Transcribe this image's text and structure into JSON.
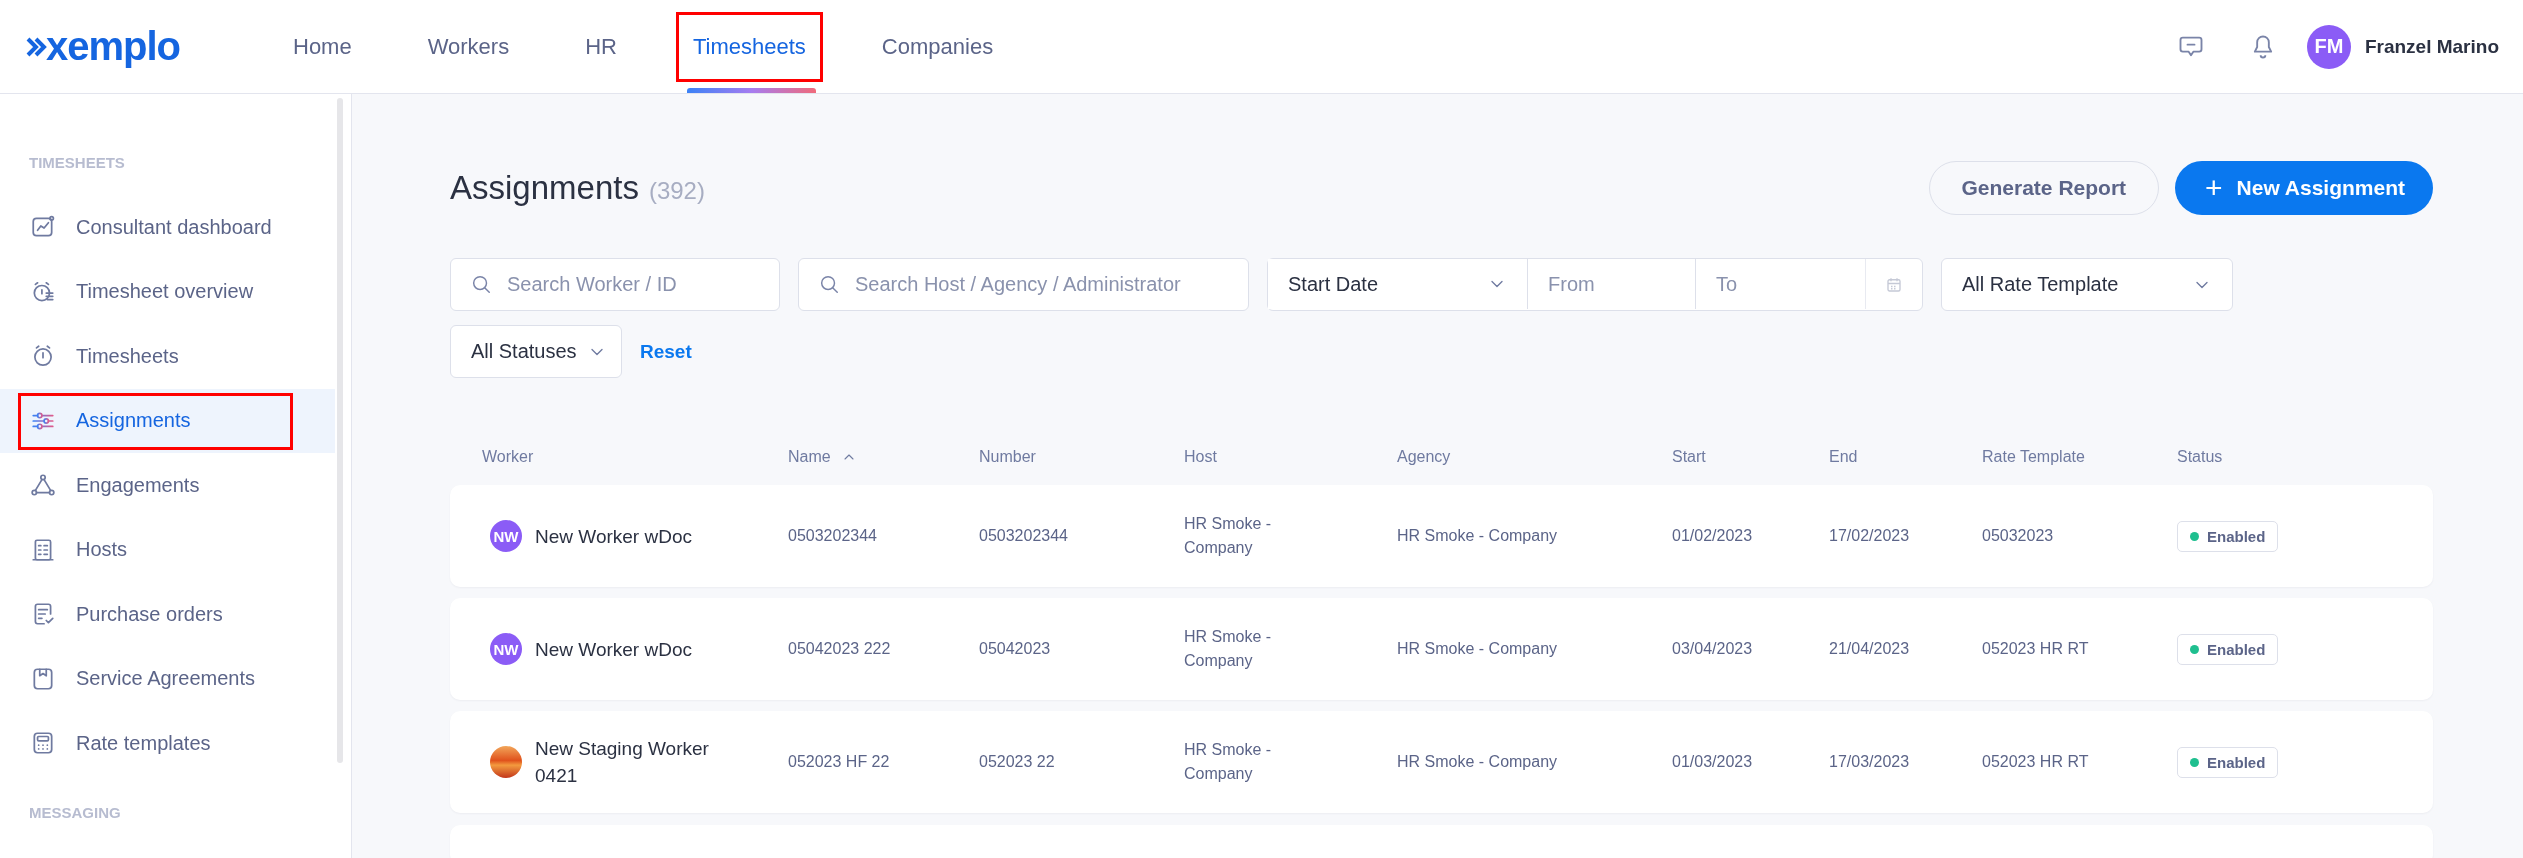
{
  "header": {
    "logo": "xemplo",
    "nav": [
      {
        "label": "Home",
        "selected": false,
        "highlighted": false
      },
      {
        "label": "Workers",
        "selected": false,
        "highlighted": false
      },
      {
        "label": "HR",
        "selected": false,
        "highlighted": false
      },
      {
        "label": "Timesheets",
        "selected": true,
        "highlighted": true
      },
      {
        "label": "Companies",
        "selected": false,
        "highlighted": false
      }
    ],
    "user": {
      "initials": "FM",
      "name": "Franzel Marino"
    }
  },
  "sidebar": {
    "sections": [
      {
        "title": "TIMESHEETS",
        "items": [
          {
            "label": "Consultant dashboard",
            "selected": false,
            "highlighted": false
          },
          {
            "label": "Timesheet overview",
            "selected": false,
            "highlighted": false
          },
          {
            "label": "Timesheets",
            "selected": false,
            "highlighted": false
          },
          {
            "label": "Assignments",
            "selected": true,
            "highlighted": true
          },
          {
            "label": "Engagements",
            "selected": false,
            "highlighted": false
          },
          {
            "label": "Hosts",
            "selected": false,
            "highlighted": false
          },
          {
            "label": "Purchase orders",
            "selected": false,
            "highlighted": false
          },
          {
            "label": "Service Agreements",
            "selected": false,
            "highlighted": false
          },
          {
            "label": "Rate templates",
            "selected": false,
            "highlighted": false
          }
        ]
      },
      {
        "title": "MESSAGING"
      }
    ]
  },
  "page": {
    "title": "Assignments",
    "count": "(392)",
    "buttons": [
      {
        "label": "Generate Report",
        "kind": "secondary"
      },
      {
        "label": "+",
        "kind": "primary",
        "text": "New Assignment"
      }
    ],
    "filters": {
      "search_worker": {
        "placeholder": "Search Worker / ID"
      },
      "search_host": {
        "placeholder": "Search Host / Agency / Administrator"
      },
      "date_type": "Start Date",
      "from": {
        "placeholder": "From"
      },
      "to": {
        "placeholder": "To"
      },
      "rate_template": "All Rate Template",
      "statuses": "All Statuses",
      "reset": "Reset"
    }
  },
  "table": {
    "columns": [
      {
        "label": "Worker",
        "sorted": false
      },
      {
        "label": "Name",
        "sorted": true
      },
      {
        "label": "Number",
        "sorted": false
      },
      {
        "label": "Host",
        "sorted": false
      },
      {
        "label": "Agency",
        "sorted": false
      },
      {
        "label": "Start",
        "sorted": false
      },
      {
        "label": "End",
        "sorted": false
      },
      {
        "label": "Rate Template",
        "sorted": false
      },
      {
        "label": "Status",
        "sorted": false
      }
    ],
    "rows": [
      {
        "avatar": {
          "kind": "initials",
          "initials": "NW"
        },
        "worker": "New Worker wDoc",
        "name": "0503202344",
        "number": "0503202344",
        "host": "HR Smoke - Company",
        "agency": "HR Smoke - Company",
        "start": "01/02/2023",
        "end": "17/02/2023",
        "rate_template": "05032023",
        "status": "Enabled"
      },
      {
        "avatar": {
          "kind": "initials",
          "initials": "NW"
        },
        "worker": "New Worker wDoc",
        "name": "05042023 222",
        "number": "05042023",
        "host": "HR Smoke - Company",
        "agency": "HR Smoke - Company",
        "start": "03/04/2023",
        "end": "21/04/2023",
        "rate_template": "052023 HR RT",
        "status": "Enabled"
      },
      {
        "avatar": {
          "kind": "picture"
        },
        "worker": "New Staging Worker 0421",
        "name": "052023 HF 22",
        "number": "052023 22",
        "host": "HR Smoke - Company",
        "agency": "HR Smoke - Company",
        "start": "01/03/2023",
        "end": "17/03/2023",
        "rate_template": "052023 HR RT",
        "status": "Enabled"
      }
    ]
  }
}
